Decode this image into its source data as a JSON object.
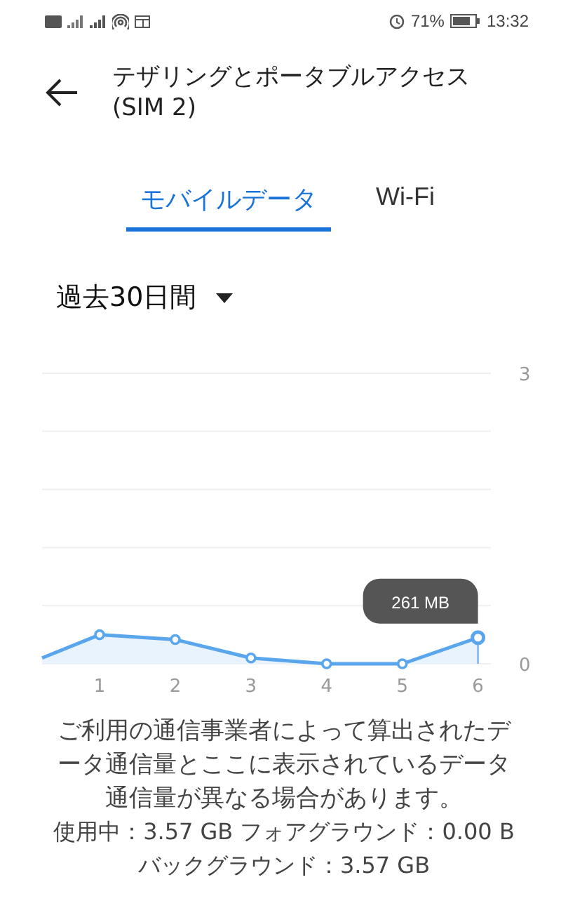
{
  "status_bar": {
    "battery": "71%",
    "time": "13:32"
  },
  "header": {
    "title": "テザリングとポータブルアクセス (SIM 2)"
  },
  "tabs": [
    {
      "label": "モバイルデータ",
      "selected": true
    },
    {
      "label": "Wi-Fi",
      "selected": false
    }
  ],
  "period": {
    "value": "過去30日間"
  },
  "chart": {
    "tooltip": "261 MB",
    "chart_data": {
      "type": "area",
      "x": [
        0.24,
        1,
        2,
        3,
        4,
        5,
        6
      ],
      "series": [
        {
          "color": "#5aa6ec",
          "values": [
            0.06,
            0.3,
            0.25,
            0.06,
            0.0,
            0.0,
            0.27
          ]
        }
      ],
      "xlim": [
        0.24,
        6.17
      ],
      "ylim": [
        0,
        3
      ],
      "yticks": [
        0,
        3
      ],
      "xticks": [
        1,
        2,
        3,
        4,
        5,
        6
      ]
    }
  },
  "note": "ご利用の通信事業者によって算出されたデータ通信量とここに表示されているデータ通信量が異なる場合があります。",
  "usage_lines": [
    "使用中：3.57 GB フォアグラウンド：0.00 B",
    "バックグラウンド：3.57 GB"
  ]
}
